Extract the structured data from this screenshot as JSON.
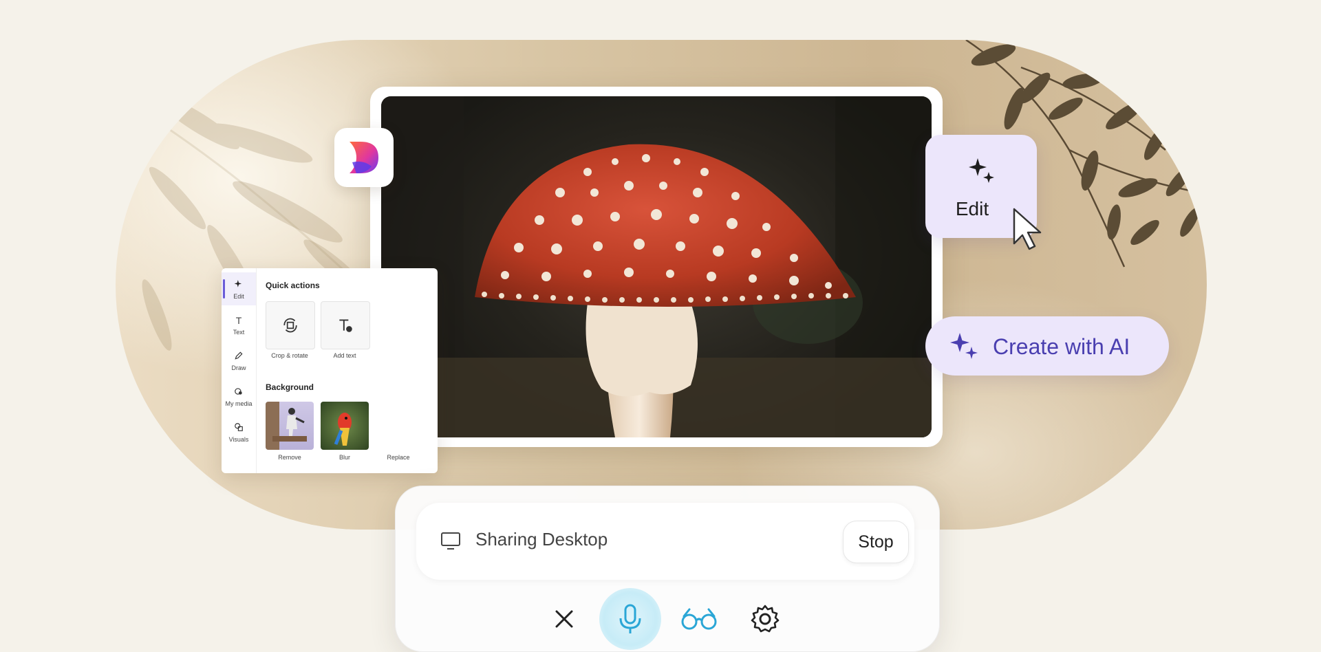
{
  "panel": {
    "rail": [
      {
        "label": "Edit",
        "icon": "sparkle-icon",
        "active": true
      },
      {
        "label": "Text",
        "icon": "text-icon"
      },
      {
        "label": "Draw",
        "icon": "pen-icon"
      },
      {
        "label": "My media",
        "icon": "media-icon"
      },
      {
        "label": "Visuals",
        "icon": "shapes-icon"
      }
    ],
    "quick_actions_heading": "Quick actions",
    "quick_actions": [
      {
        "label": "Crop & rotate",
        "icon": "crop-rotate-icon"
      },
      {
        "label": "Add text",
        "icon": "add-text-icon"
      }
    ],
    "background_heading": "Background",
    "background_actions": [
      {
        "label": "Remove"
      },
      {
        "label": "Blur"
      },
      {
        "label": "Replace"
      }
    ]
  },
  "edit_card": {
    "label": "Edit",
    "icon": "sparkle-icon"
  },
  "ai_button": {
    "label": "Create with AI",
    "icon": "sparkle-icon"
  },
  "call_bar": {
    "status": "Sharing Desktop",
    "stop_label": "Stop",
    "controls": [
      "close-icon",
      "microphone-icon",
      "glasses-icon",
      "settings-icon"
    ]
  },
  "colors": {
    "accent_purple": "#4a3fb0",
    "card_lavender": "#ece6fb",
    "mic_blue": "#2aa6d6"
  }
}
